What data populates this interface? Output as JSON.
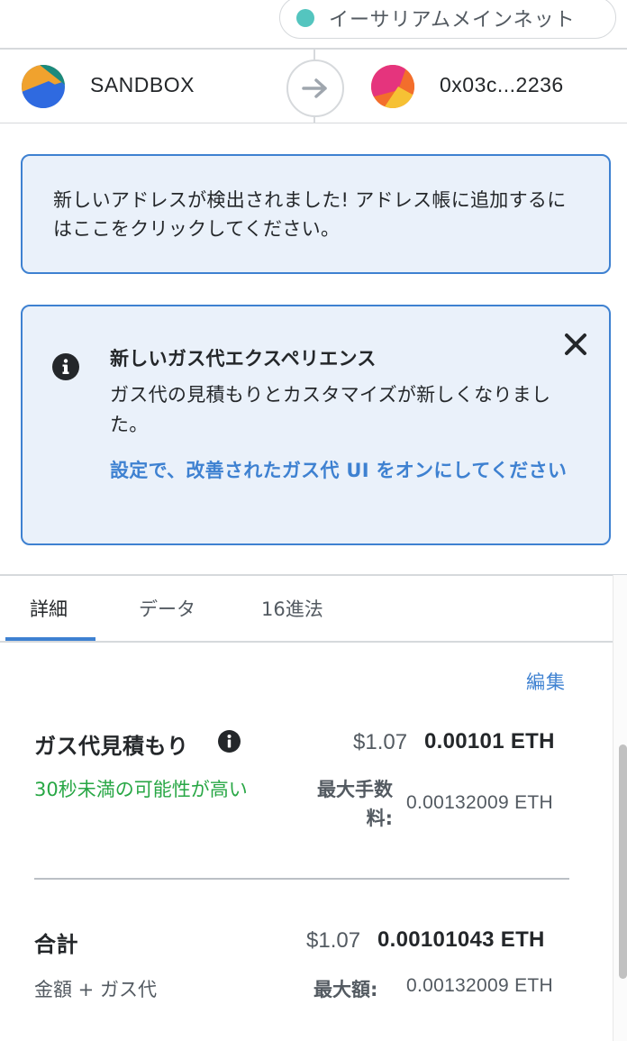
{
  "network": {
    "label": "イーサリアムメインネット",
    "dot_color": "#29b6af"
  },
  "sender": {
    "name": "SANDBOX",
    "avatar_icon": "jazzicon-avatar"
  },
  "recipient": {
    "name": "0x03c...2236",
    "avatar_icon": "jazzicon-avatar"
  },
  "address_notice": {
    "text": "新しいアドレスが検出されました! アドレス帳に追加するにはここをクリックしてください。"
  },
  "gas_notice": {
    "title": "新しいガス代エクスペリエンス",
    "description": "ガス代の見積もりとカスタマイズが新しくなりました。",
    "link": "設定で、改善されたガス代 UI をオンにしてください",
    "close_icon": "close-icon"
  },
  "tabs": [
    {
      "label": "詳細",
      "active": true
    },
    {
      "label": "データ",
      "active": false
    },
    {
      "label": "16進法",
      "active": false
    }
  ],
  "details": {
    "edit_label": "編集",
    "gas_estimate": {
      "label": "ガス代見積もり",
      "fiat": "$1.07",
      "eth": "0.00101 ETH",
      "speed": "30秒未満の可能性が高い",
      "max_fee_label": "最大手数料:",
      "max_fee_value": "0.00132009 ETH"
    },
    "total": {
      "label": "合計",
      "fiat": "$1.07",
      "eth": "0.00101043 ETH",
      "sub_label": "金額 + ガス代",
      "max_amount_label": "最大額:",
      "max_amount_value": "0.00132009 ETH"
    }
  },
  "colors": {
    "accent": "#3e81d1",
    "success": "#28a745",
    "notice_bg": "#eaf1fa"
  }
}
